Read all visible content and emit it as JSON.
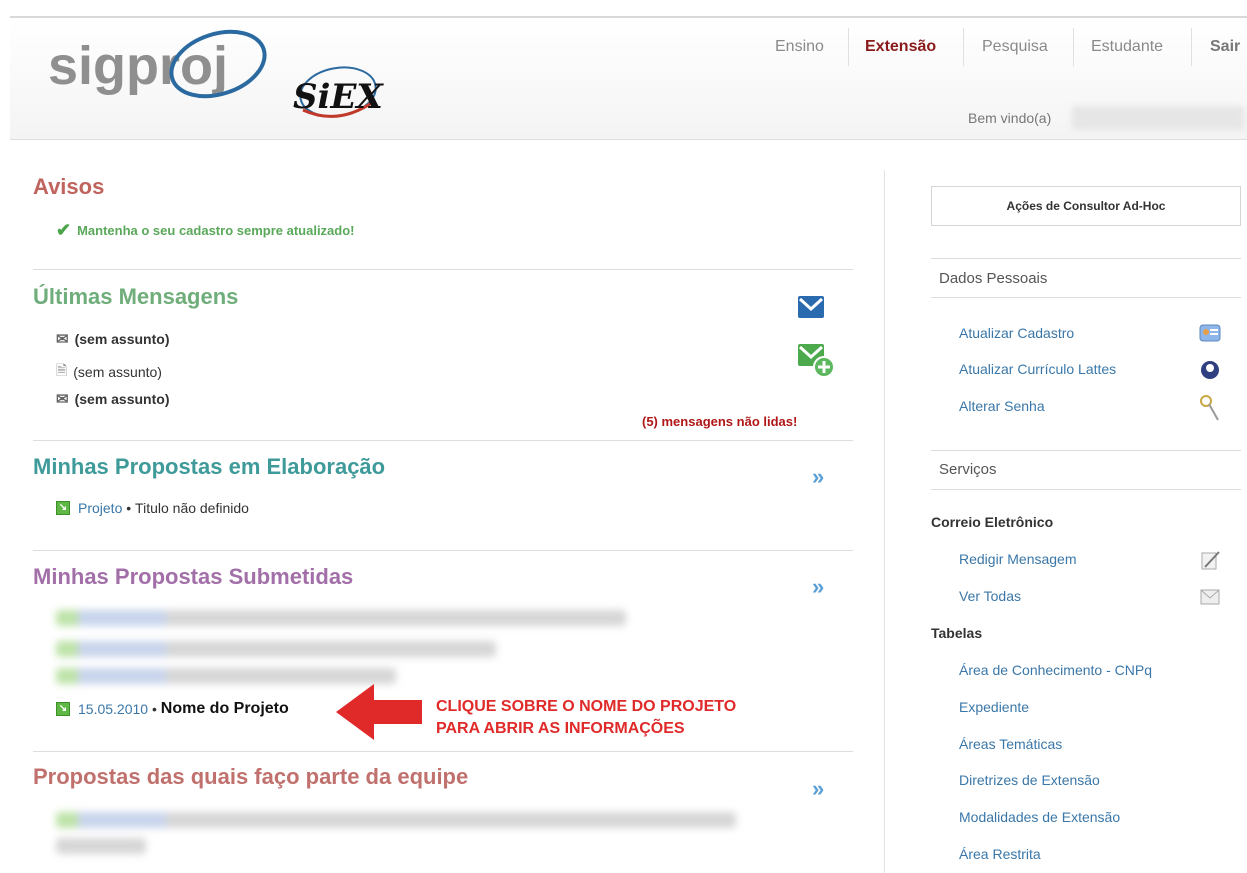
{
  "header": {
    "logo_text": "sigproj",
    "logo_sub": "SiEX",
    "nav": [
      "Ensino",
      "Extensão",
      "Pesquisa",
      "Estudante",
      "Sair"
    ],
    "welcome": "Bem vindo(a)"
  },
  "avisos": {
    "title": "Avisos",
    "message": "Mantenha o seu cadastro sempre atualizado!"
  },
  "mensagens": {
    "title": "Últimas Mensagens",
    "items": [
      "(sem assunto)",
      "(sem assunto)",
      "(sem assunto)"
    ],
    "unread": "(5) mensagens não lidas!"
  },
  "elaboracao": {
    "title": "Minhas Propostas em Elaboração",
    "item_link": "Projeto",
    "item_sep": " • ",
    "item_text": "Titulo não definido"
  },
  "submetidas": {
    "title": "Minhas Propostas Submetidas",
    "item_date": "15.05.2010",
    "item_sep": " • ",
    "item_name": "Nome do Projeto",
    "callout_line1": "CLIQUE SOBRE O NOME DO PROJETO",
    "callout_line2": "PARA ABRIR AS INFORMAÇÕES"
  },
  "equipe": {
    "title": "Propostas das quais faço parte da equipe"
  },
  "sidebar": {
    "adhoc_button": "Ações de Consultor Ad-Hoc",
    "dados_title": "Dados Pessoais",
    "dados_links": [
      "Atualizar Cadastro",
      "Atualizar Currículo Lattes",
      "Alterar Senha"
    ],
    "servicos_title": "Serviços",
    "correio_title": "Correio Eletrônico",
    "correio_links": [
      "Redigir Mensagem",
      "Ver Todas"
    ],
    "tabelas_title": "Tabelas",
    "tabelas_links": [
      "Área de Conhecimento - CNPq",
      "Expediente",
      "Áreas Temáticas",
      "Diretrizes de Extensão",
      "Modalidades de Extensão",
      "Área Restrita"
    ]
  },
  "colors": {
    "avisos": "#c0645e",
    "mensagens": "#6fae7a",
    "elaboracao": "#3f9a9a",
    "submetidas": "#a26fa8",
    "equipe": "#c0716d",
    "link": "#3a77a8",
    "alert": "#b01818",
    "callout": "#e02a2a"
  }
}
